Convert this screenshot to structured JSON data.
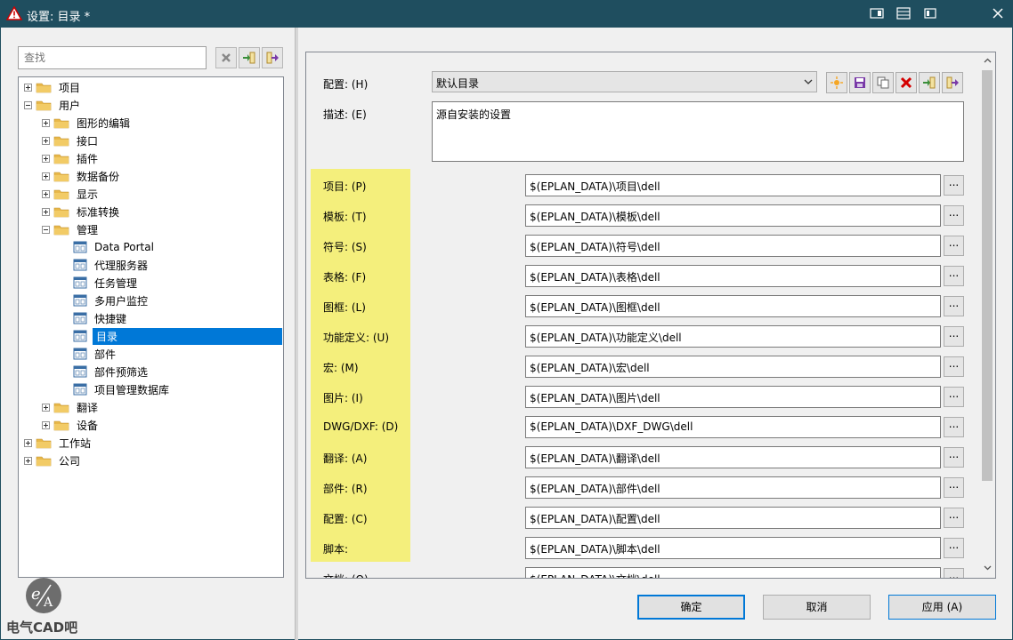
{
  "window": {
    "title": "设置: 目录 *"
  },
  "left": {
    "search_placeholder": "查找",
    "tree": [
      {
        "label": "项目",
        "level": 0,
        "type": "folder",
        "expander": "plus"
      },
      {
        "label": "用户",
        "level": 0,
        "type": "folder",
        "expander": "minus"
      },
      {
        "label": "图形的编辑",
        "level": 1,
        "type": "folder",
        "expander": "plus"
      },
      {
        "label": "接口",
        "level": 1,
        "type": "folder",
        "expander": "plus"
      },
      {
        "label": "插件",
        "level": 1,
        "type": "folder",
        "expander": "plus"
      },
      {
        "label": "数据备份",
        "level": 1,
        "type": "folder",
        "expander": "plus"
      },
      {
        "label": "显示",
        "level": 1,
        "type": "folder",
        "expander": "plus"
      },
      {
        "label": "标准转换",
        "level": 1,
        "type": "folder",
        "expander": "plus"
      },
      {
        "label": "管理",
        "level": 1,
        "type": "folder",
        "expander": "minus"
      },
      {
        "label": "Data Portal",
        "level": 2,
        "type": "page"
      },
      {
        "label": "代理服务器",
        "level": 2,
        "type": "page"
      },
      {
        "label": "任务管理",
        "level": 2,
        "type": "page"
      },
      {
        "label": "多用户监控",
        "level": 2,
        "type": "page"
      },
      {
        "label": "快捷键",
        "level": 2,
        "type": "page"
      },
      {
        "label": "目录",
        "level": 2,
        "type": "page",
        "selected": true
      },
      {
        "label": "部件",
        "level": 2,
        "type": "page"
      },
      {
        "label": "部件预筛选",
        "level": 2,
        "type": "page"
      },
      {
        "label": "项目管理数据库",
        "level": 2,
        "type": "page"
      },
      {
        "label": "翻译",
        "level": 1,
        "type": "folder",
        "expander": "plus"
      },
      {
        "label": "设备",
        "level": 1,
        "type": "folder",
        "expander": "plus"
      },
      {
        "label": "工作站",
        "level": 0,
        "type": "folder",
        "expander": "plus"
      },
      {
        "label": "公司",
        "level": 0,
        "type": "folder",
        "expander": "plus"
      }
    ]
  },
  "watermark": {
    "text": "电气CAD吧"
  },
  "right": {
    "config_label": "配置: (H)",
    "config_value": "默认目录",
    "desc_label": "描述: (E)",
    "desc_value": "源自安装的设置",
    "browse_label": "...",
    "paths": [
      {
        "label": "项目: (P)",
        "value": "$(EPLAN_DATA)\\项目\\dell"
      },
      {
        "label": "模板: (T)",
        "value": "$(EPLAN_DATA)\\模板\\dell"
      },
      {
        "label": "符号: (S)",
        "value": "$(EPLAN_DATA)\\符号\\dell"
      },
      {
        "label": "表格: (F)",
        "value": "$(EPLAN_DATA)\\表格\\dell"
      },
      {
        "label": "图框: (L)",
        "value": "$(EPLAN_DATA)\\图框\\dell"
      },
      {
        "label": "功能定义: (U)",
        "value": "$(EPLAN_DATA)\\功能定义\\dell"
      },
      {
        "label": "宏: (M)",
        "value": "$(EPLAN_DATA)\\宏\\dell"
      },
      {
        "label": "图片: (I)",
        "value": "$(EPLAN_DATA)\\图片\\dell"
      },
      {
        "label": "DWG/DXF: (D)",
        "value": "$(EPLAN_DATA)\\DXF_DWG\\dell"
      },
      {
        "label": "翻译: (A)",
        "value": "$(EPLAN_DATA)\\翻译\\dell"
      },
      {
        "label": "部件: (R)",
        "value": "$(EPLAN_DATA)\\部件\\dell"
      },
      {
        "label": "配置: (C)",
        "value": "$(EPLAN_DATA)\\配置\\dell"
      },
      {
        "label": "脚本:",
        "value": "$(EPLAN_DATA)\\脚本\\dell"
      },
      {
        "label": "文档: (O)",
        "value": "$(EPLAN_DATA)\\文档\\dell"
      }
    ]
  },
  "buttons": {
    "ok": "确定",
    "cancel": "取消",
    "apply": "应用 (A)"
  },
  "colors": {
    "titlebar": "#1f4e5f",
    "selection": "#0078d7",
    "highlight": "#f4ef7c",
    "folder": "#e8b84a"
  }
}
